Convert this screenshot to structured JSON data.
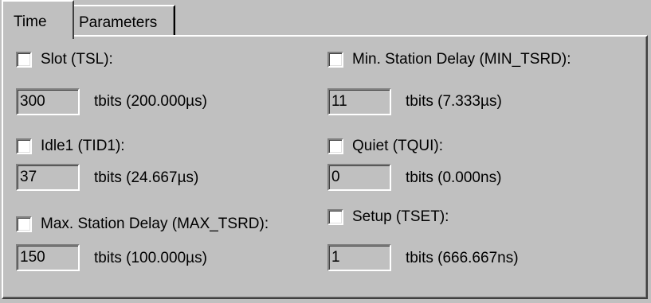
{
  "tabs": {
    "time_label": "Time",
    "parameters_label": "Parameters"
  },
  "left": {
    "slot": {
      "label": "Slot (TSL):",
      "value": "300",
      "unit": "tbits (200.000µs)"
    },
    "idle1": {
      "label": "Idle1 (TID1):",
      "value": "37",
      "unit": "tbits (24.667µs)"
    },
    "max_station_delay": {
      "label": "Max. Station Delay (MAX_TSRD):",
      "value": "150",
      "unit": "tbits (100.000µs)"
    }
  },
  "right": {
    "min_station_delay": {
      "label": "Min. Station Delay (MIN_TSRD):",
      "value": "11",
      "unit": "tbits (7.333µs)"
    },
    "quiet": {
      "label": "Quiet (TQUI):",
      "value": "0",
      "unit": "tbits (0.000ns)"
    },
    "setup": {
      "label": "Setup (TSET):",
      "value": "1",
      "unit": "tbits (666.667ns)"
    }
  }
}
